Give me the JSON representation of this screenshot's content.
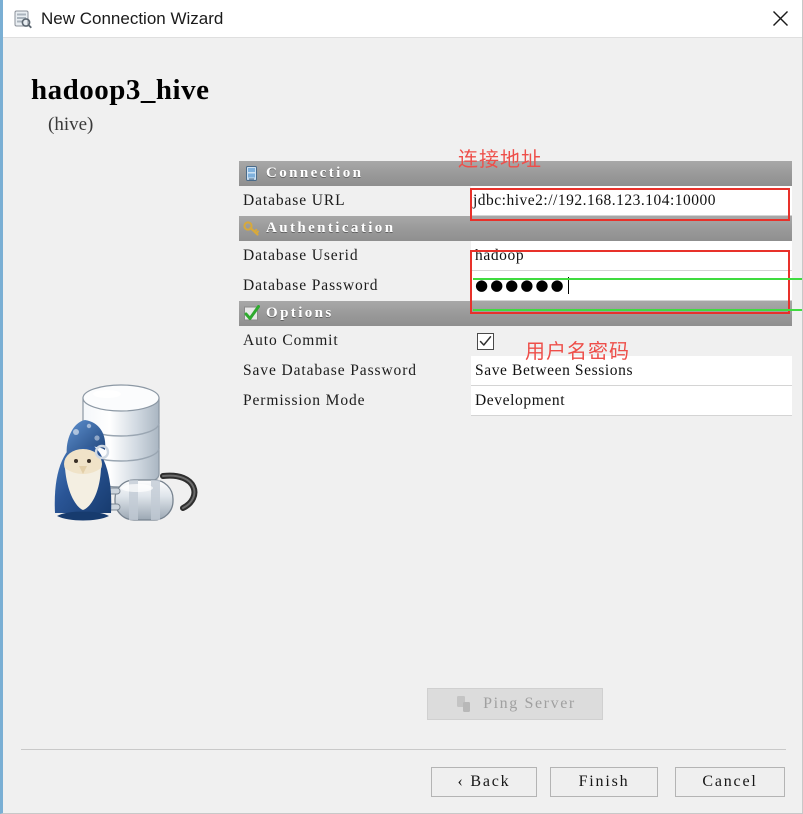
{
  "window": {
    "title": "New Connection Wizard",
    "title_icon": "database-wizard-icon",
    "close_icon": "close-icon"
  },
  "heading": {
    "name": "hadoop3_hive",
    "driver": "(hive)"
  },
  "logo": {
    "icon": "squirrel-sql-database-plug-icon"
  },
  "sections": [
    {
      "id": "connection",
      "icon": "database-server-icon",
      "label": "Connection",
      "fields": [
        {
          "id": "database-url",
          "label": "Database URL",
          "value": "jdbc:hive2://192.168.123.104:10000",
          "type": "text"
        }
      ]
    },
    {
      "id": "authentication",
      "icon": "key-icon",
      "label": "Authentication",
      "fields": [
        {
          "id": "database-userid",
          "label": "Database Userid",
          "value": "hadoop",
          "type": "text"
        },
        {
          "id": "database-password",
          "label": "Database Password",
          "value": "●●●●●●",
          "type": "password"
        }
      ]
    },
    {
      "id": "options",
      "icon": "green-check-icon",
      "label": "Options",
      "fields": [
        {
          "id": "auto-commit",
          "label": "Auto Commit",
          "value": "",
          "type": "checkbox",
          "checked": true
        },
        {
          "id": "save-database-password",
          "label": "Save Database Password",
          "value": "Save Between Sessions",
          "type": "select"
        },
        {
          "id": "permission-mode",
          "label": "Permission Mode",
          "value": "Development",
          "type": "select"
        }
      ]
    }
  ],
  "annotations": [
    {
      "id": "connection-address-note",
      "text": "连接地址",
      "color": "#ee4f4a"
    },
    {
      "id": "username-password-note",
      "text": "用户名密码",
      "color": "#ee4f4a"
    }
  ],
  "ping": {
    "label": "Ping Server",
    "icon": "server-plug-icon",
    "enabled": false
  },
  "footer": {
    "back_label": "‹ Back",
    "finish_label": "Finish",
    "cancel_label": "Cancel"
  },
  "colors": {
    "highlight_box": "#e8312a",
    "focus_underline": "#3fdb3f",
    "section_header": "#9a9a9a",
    "window_accent": "#7aafd4"
  }
}
